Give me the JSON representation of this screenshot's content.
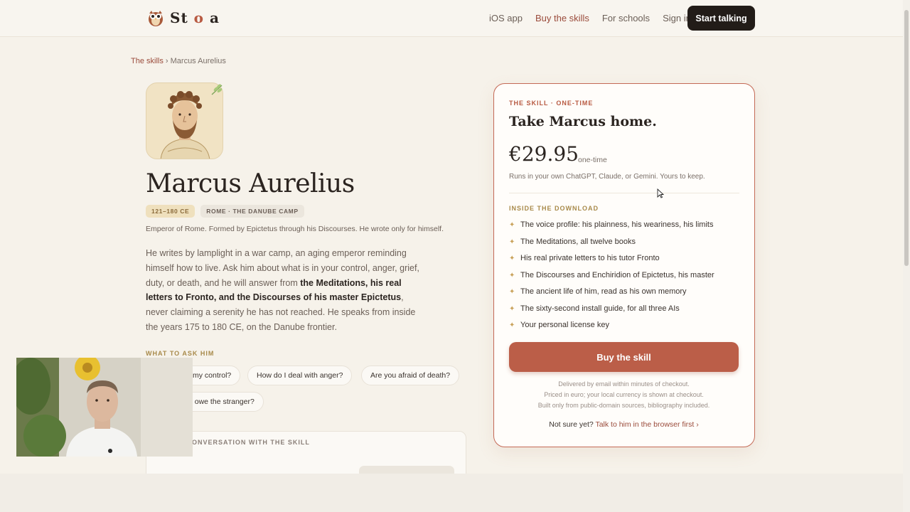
{
  "header": {
    "logo_prefix": "St",
    "logo_o": "o",
    "logo_suffix": "a",
    "nav": [
      "iOS app",
      "Buy the skills",
      "For schools",
      "Sign in"
    ],
    "cta": "Start talking"
  },
  "breadcrumb": {
    "link": "The skills",
    "sep": " › ",
    "current": "Marcus Aurelius"
  },
  "profile": {
    "name": "Marcus Aurelius",
    "years": "121–180 CE",
    "place": "ROME · THE DANUBE CAMP",
    "subtitle": "Emperor of Rome. Formed by Epictetus through his Discourses. He wrote only for himself.",
    "bio_1": "He writes by lamplight in a war camp, an aging emperor reminding himself how to live. Ask him about what is in your control, anger, grief, duty, or death, and he will answer from ",
    "bio_bold": "the Meditations, his real letters to Fronto, and the Discourses of his master Epictetus",
    "bio_2": ", never claiming a serenity he has not reached. He speaks from inside the years 175 to 180 CE, on the Danube frontier."
  },
  "ask": {
    "label": "WHAT TO ASK HIM",
    "questions": [
      "my control?",
      "How do I deal with anger?",
      "Are you afraid of death?",
      "e owe the stranger?"
    ]
  },
  "conversation": {
    "label": "ONVERSATION WITH THE SKILL"
  },
  "card": {
    "eyebrow": "THE SKILL · ONE-TIME",
    "title": "Take Marcus home.",
    "price": "€29.95",
    "price_note": "one-time",
    "runs": "Runs in your own ChatGPT, Claude, or Gemini. Yours to keep.",
    "inside_label": "INSIDE THE DOWNLOAD",
    "features": [
      "The voice profile: his plainness, his weariness, his limits",
      "The Meditations, all twelve books",
      "His real private letters to his tutor Fronto",
      "The Discourses and Enchiridion of Epictetus, his master",
      "The ancient life of him, read as his own memory",
      "The sixty-second install guide, for all three AIs",
      "Your personal license key"
    ],
    "buy_label": "Buy the skill",
    "fine_1": "Delivered by email within minutes of checkout.",
    "fine_2": "Priced in euro; your local currency is shown at checkout.",
    "fine_3": "Built only from public-domain sources, bibliography included.",
    "not_sure": "Not sure yet? ",
    "not_sure_link": "Talk to him in the browser first ›"
  },
  "colors": {
    "accent": "#bb5e48",
    "dark": "#221c18",
    "gold": "#a88a4a",
    "bg": "#f6f2ea"
  }
}
